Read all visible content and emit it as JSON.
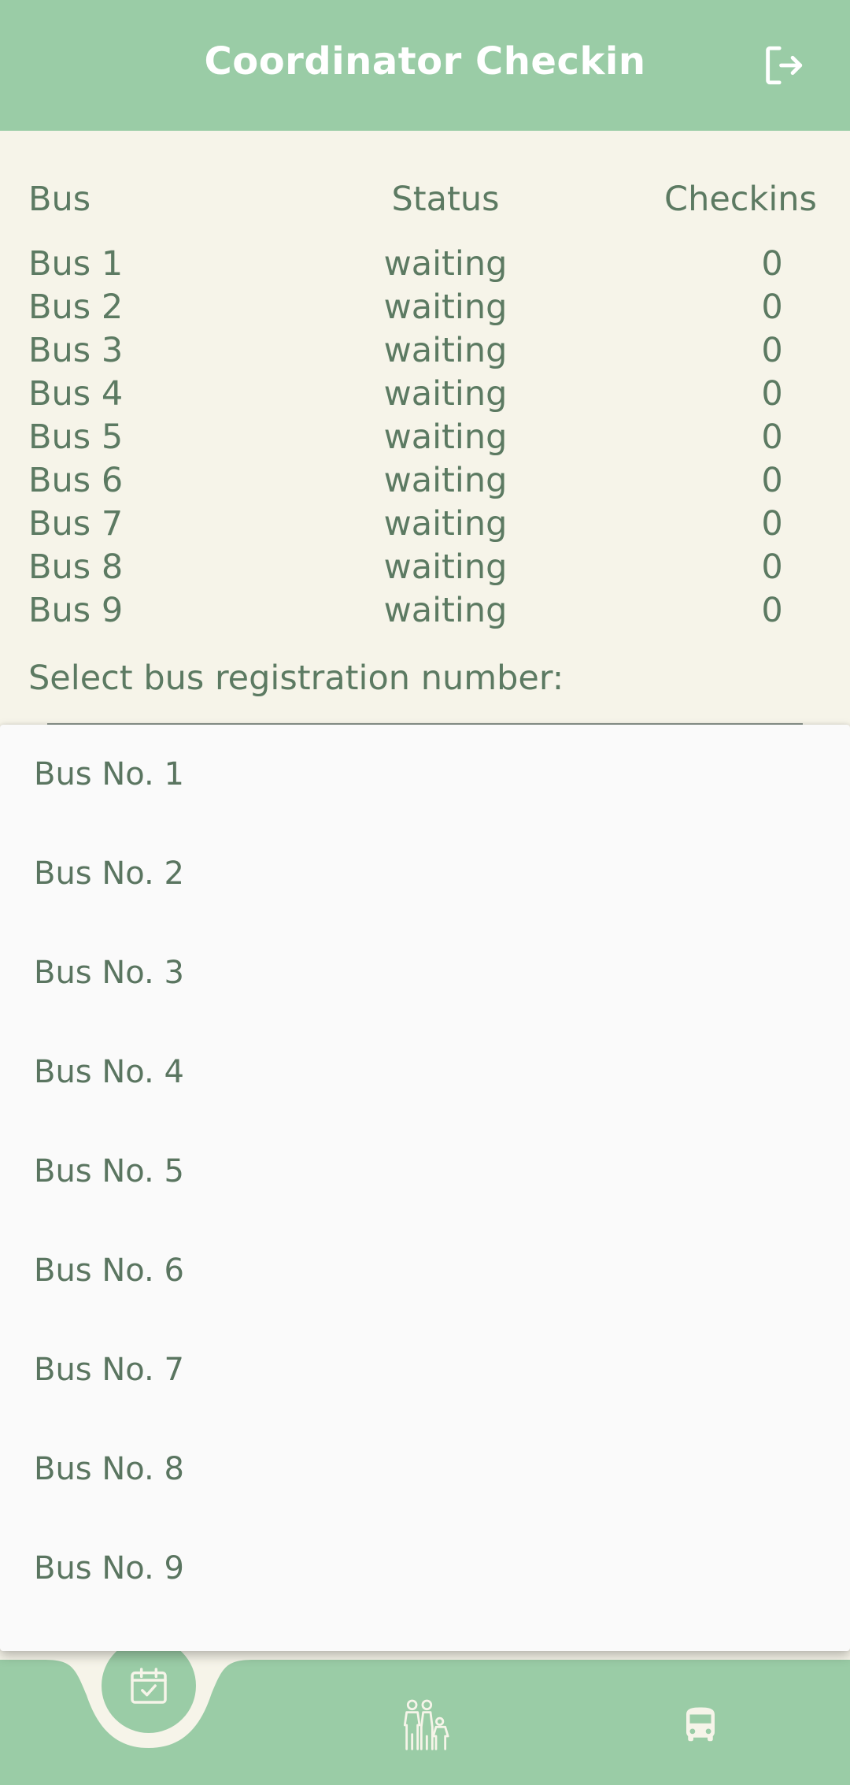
{
  "header": {
    "title": "Coordinator Checkin",
    "logout_icon": "logout-icon"
  },
  "table": {
    "headers": {
      "bus": "Bus",
      "status": "Status",
      "checkins": "Checkins"
    },
    "rows": [
      {
        "bus": "Bus 1",
        "status": "waiting",
        "checkins": "0"
      },
      {
        "bus": "Bus 2",
        "status": "waiting",
        "checkins": "0"
      },
      {
        "bus": "Bus 3",
        "status": "waiting",
        "checkins": "0"
      },
      {
        "bus": "Bus 4",
        "status": "waiting",
        "checkins": "0"
      },
      {
        "bus": "Bus 5",
        "status": "waiting",
        "checkins": "0"
      },
      {
        "bus": "Bus 6",
        "status": "waiting",
        "checkins": "0"
      },
      {
        "bus": "Bus 7",
        "status": "waiting",
        "checkins": "0"
      },
      {
        "bus": "Bus 8",
        "status": "waiting",
        "checkins": "0"
      },
      {
        "bus": "Bus 9",
        "status": "waiting",
        "checkins": "0"
      }
    ]
  },
  "select": {
    "label": "Select bus registration number:",
    "options": [
      "Bus No. 1",
      "Bus No. 2",
      "Bus No. 3",
      "Bus No. 4",
      "Bus No. 5",
      "Bus No. 6",
      "Bus No. 7",
      "Bus No. 8",
      "Bus No. 9"
    ]
  },
  "bottom_nav": {
    "tabs": [
      {
        "icon": "calendar-check-icon",
        "active": true
      },
      {
        "icon": "family-icon",
        "active": false
      },
      {
        "icon": "bus-icon",
        "active": false
      }
    ]
  },
  "colors": {
    "primary": "#9acca6",
    "background": "#f6f4e9",
    "text": "#5c7a62",
    "menu_background": "#fafafa",
    "on_primary": "#ffffff"
  }
}
